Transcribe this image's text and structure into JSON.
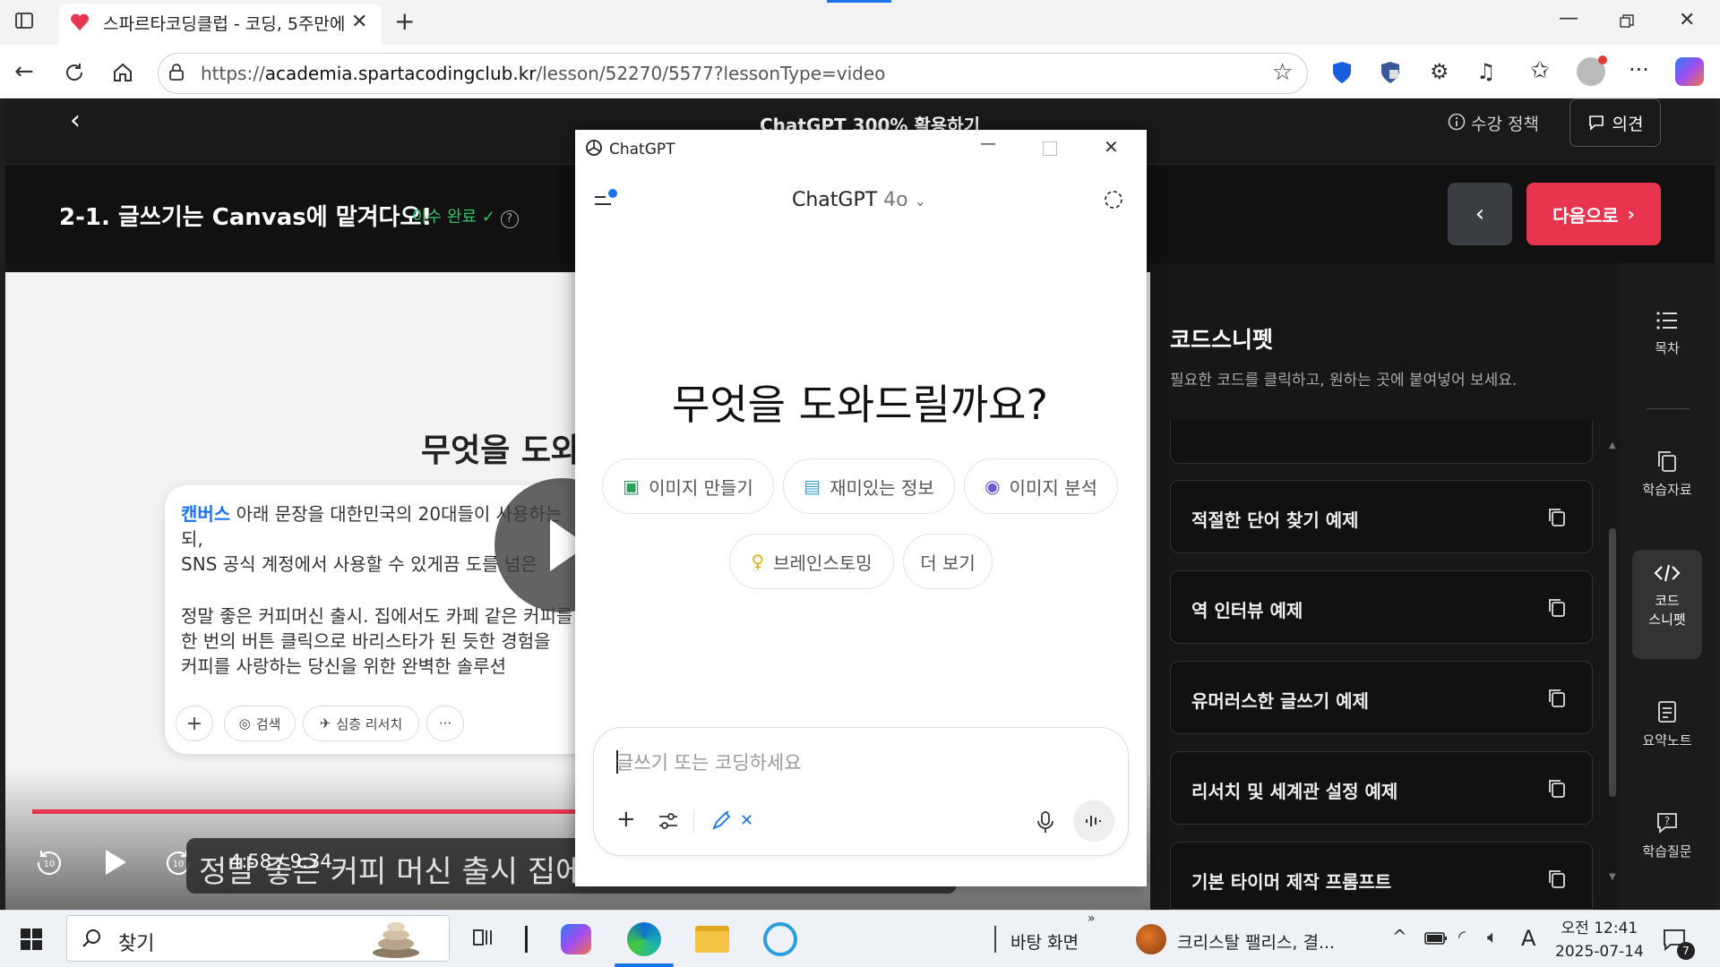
{
  "browser": {
    "tab_title": "스파르타코딩클럽 - 코딩, 5주만에",
    "url_domain": "academia.spartacodingclub.kr",
    "url_prefix": "https://",
    "url_path": "/lesson/52270/5577?lessonType=video"
  },
  "page": {
    "course_title": "ChatGPT 300% 활용하기",
    "policy_label": "수강 정책",
    "opinion_label": "의견",
    "lesson_title": "2-1. 글쓰기는 Canvas에 맡겨다오!",
    "done_label": "이수 완료",
    "next_label": "다음으로"
  },
  "video": {
    "heading": "무엇을 도와",
    "canvas_label": "캔버스",
    "line1": "아래 문장을 대한민국의 20대들이 사용하는",
    "line2": "되,",
    "line3": "SNS 공식 계정에서 사용할 수 있게끔 도를 넘은",
    "line4": "정말 좋은 커피머신 출시. 집에서도 카페 같은 커피를",
    "line5": "한 번의 버튼 클릭으로 바리스타가 된 듯한 경험을",
    "line6": "커피를 사랑하는 당신을 위한 완벽한 솔루션",
    "chip_search": "검색",
    "chip_research": "심층 리서치",
    "chip_more": "···",
    "subtitle": "정말 좋은 커피 머신 출시 집에서",
    "time_current": "4:58",
    "time_sep": "/",
    "time_total": "9:34",
    "progress_fraction": 0.5
  },
  "snippets": {
    "title": "코드스니펫",
    "subtitle": "필요한 코드를 클릭하고, 원하는 곳에 붙여넣어 보세요.",
    "items": [
      {
        "label": "적절한 단어 찾기 예제"
      },
      {
        "label": "역 인터뷰 예제"
      },
      {
        "label": "유머러스한 글쓰기 예제"
      },
      {
        "label": "리서치 및 세계관 설정 예제"
      },
      {
        "label": "기본 타이머 제작 프롬프트"
      }
    ]
  },
  "rail": {
    "toc": "목차",
    "materials": "학습자료",
    "snippet_1": "코드",
    "snippet_2": "스니펫",
    "summary": "요약노트",
    "question": "학습질문"
  },
  "chatgpt": {
    "window_title": "ChatGPT",
    "model_name": "ChatGPT",
    "model_version": "4o",
    "greeting": "무엇을 도와드릴까요?",
    "chips": [
      {
        "label": "이미지 만들기"
      },
      {
        "label": "재미있는 정보"
      },
      {
        "label": "이미지 분석"
      },
      {
        "label": "브레인스토밍"
      },
      {
        "label": "더 보기"
      }
    ],
    "input_placeholder": "글쓰기 또는 코딩하세요"
  },
  "taskbar": {
    "search_label": "찾기",
    "desktop_label": "바탕 화면",
    "media_label": "크리스탈 팰리스, 결...",
    "clock_time": "오전 12:41",
    "clock_date": "2025-07-14",
    "ime_label": "A",
    "notification_count": "7"
  },
  "colors": {
    "accent_red": "#e8344e",
    "done_green": "#33c36b",
    "link_blue": "#1a73e8"
  }
}
